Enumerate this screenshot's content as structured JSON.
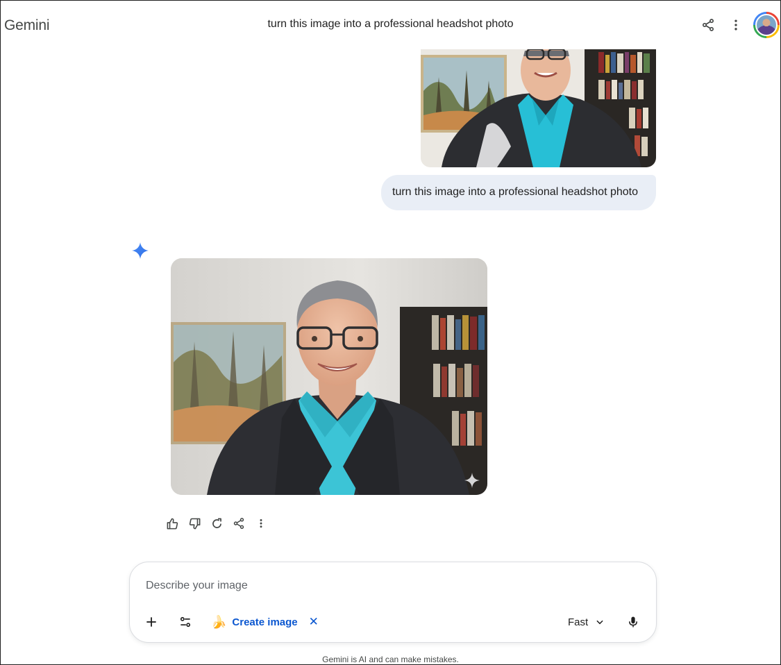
{
  "app": {
    "title": "Gemini"
  },
  "conversation": {
    "title": "turn this image into a professional headshot photo"
  },
  "icons": {
    "share": "share-icon",
    "more": "more-vert-icon",
    "spark": "gemini-spark-icon",
    "thumbs_up": "thumbs-up-icon",
    "thumbs_down": "thumbs-down-icon",
    "regenerate": "redo-icon",
    "plus": "plus-icon",
    "tools": "tune-icon",
    "mic": "mic-icon",
    "watermark": "sparkle-watermark-icon"
  },
  "user_message": {
    "text": "turn this image into a professional headshot photo"
  },
  "composer": {
    "placeholder": "Describe your image",
    "tool_chip": {
      "emoji": "🍌",
      "label": "Create image",
      "close": "✕"
    },
    "mode": "Fast"
  },
  "footer": {
    "disclaimer": "Gemini is AI and can make mistakes."
  },
  "colors": {
    "accent": "#0b57d0",
    "bubble": "#e9eef6",
    "spark": "#4285f4"
  }
}
